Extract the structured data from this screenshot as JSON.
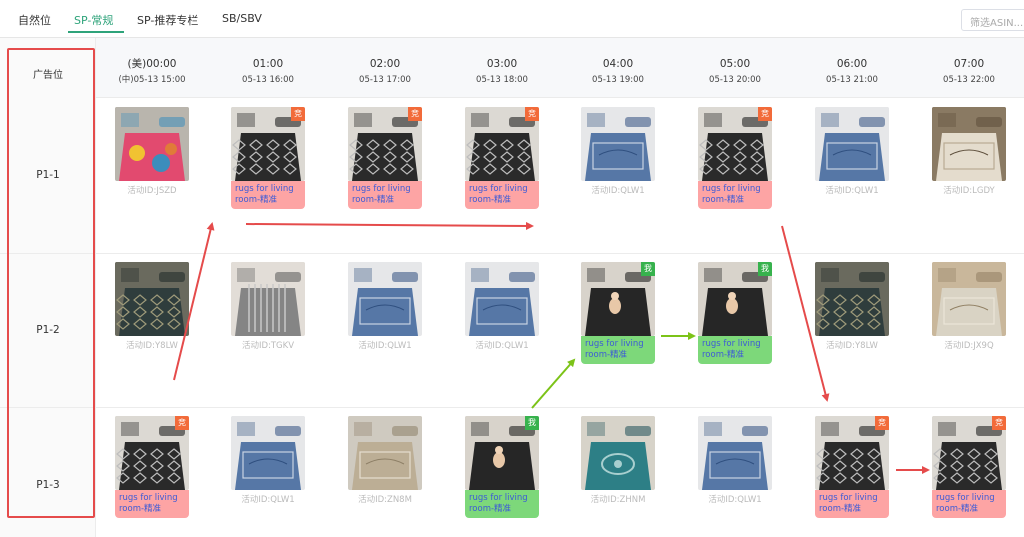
{
  "tabs": [
    {
      "label": "自然位",
      "active": false
    },
    {
      "label": "SP-常规",
      "active": true
    },
    {
      "label": "SP-推荐专栏",
      "active": false
    },
    {
      "label": "SB/SBV",
      "active": false
    }
  ],
  "filter": {
    "placeholder": "筛选ASIN..."
  },
  "header": {
    "slot_label": "广告位"
  },
  "columns": [
    {
      "us_time": "(美)00:00",
      "cn_time": "(中)05-13 15:00"
    },
    {
      "us_time": "01:00",
      "cn_time": "05-13 16:00"
    },
    {
      "us_time": "02:00",
      "cn_time": "05-13 17:00"
    },
    {
      "us_time": "03:00",
      "cn_time": "05-13 18:00"
    },
    {
      "us_time": "04:00",
      "cn_time": "05-13 19:00"
    },
    {
      "us_time": "05:00",
      "cn_time": "05-13 20:00"
    },
    {
      "us_time": "06:00",
      "cn_time": "05-13 21:00"
    },
    {
      "us_time": "07:00",
      "cn_time": "05-13 22:00"
    }
  ],
  "rows": [
    {
      "label": "P1-1",
      "cells": [
        {
          "kind": "id",
          "text": "活动ID:JSZD",
          "style": "colorful-rug"
        },
        {
          "kind": "keyword",
          "tag": "竞",
          "text": "rugs for living room-精准",
          "style": "black-diamond-rug"
        },
        {
          "kind": "keyword",
          "tag": "竞",
          "text": "rugs for living room-精准",
          "style": "black-diamond-rug"
        },
        {
          "kind": "keyword",
          "tag": "竞",
          "text": "rugs for living room-精准",
          "style": "black-diamond-rug"
        },
        {
          "kind": "id",
          "text": "活动ID:QLW1",
          "style": "blue-rug"
        },
        {
          "kind": "keyword",
          "tag": "竞",
          "text": "rugs for living room-精准",
          "style": "black-diamond-rug"
        },
        {
          "kind": "id",
          "text": "活动ID:QLW1",
          "style": "blue-rug"
        },
        {
          "kind": "id",
          "text": "活动ID:LGDY",
          "style": "cream-rug"
        }
      ]
    },
    {
      "label": "P1-2",
      "cells": [
        {
          "kind": "id",
          "text": "活动ID:Y8LW",
          "style": "dark-floral-rug"
        },
        {
          "kind": "id",
          "text": "活动ID:TGKV",
          "style": "grey-striped-rug"
        },
        {
          "kind": "id",
          "text": "活动ID:QLW1",
          "style": "blue-rug"
        },
        {
          "kind": "id",
          "text": "活动ID:QLW1",
          "style": "blue-rug"
        },
        {
          "kind": "keyword",
          "tag": "我",
          "tag_type": "mine",
          "text": "rugs for living room-精准",
          "style": "black-shag-rug"
        },
        {
          "kind": "keyword",
          "tag": "我",
          "tag_type": "mine",
          "text": "rugs for living room-精准",
          "style": "black-shag-rug"
        },
        {
          "kind": "id",
          "text": "活动ID:Y8LW",
          "style": "dark-floral-rug"
        },
        {
          "kind": "id",
          "text": "活动ID:JX9Q",
          "style": "beige-room-rug"
        }
      ]
    },
    {
      "label": "P1-3",
      "cells": [
        {
          "kind": "keyword",
          "tag": "竞",
          "text": "rugs for living room-精准",
          "style": "black-diamond-rug"
        },
        {
          "kind": "id",
          "text": "活动ID:QLW1",
          "style": "blue-rug"
        },
        {
          "kind": "id",
          "text": "活动ID:ZN8M",
          "style": "beige-leaf-rug"
        },
        {
          "kind": "keyword",
          "tag": "我",
          "tag_type": "mine",
          "text": "rugs for living room-精准",
          "style": "black-shag-rug"
        },
        {
          "kind": "id",
          "text": "活动ID:ZHNM",
          "style": "teal-medallion-rug"
        },
        {
          "kind": "id",
          "text": "活动ID:QLW1",
          "style": "blue-rug"
        },
        {
          "kind": "keyword",
          "tag": "竞",
          "text": "rugs for living room-精准",
          "style": "black-diamond-rug"
        },
        {
          "kind": "keyword",
          "tag": "竞",
          "text": "rugs for living room-精准",
          "style": "black-diamond-rug"
        }
      ]
    }
  ],
  "colors": {
    "accent": "#2ea37a",
    "competitor_tag": "#f26b3a",
    "mine_tag": "#37b24d",
    "competitor_caption": "#fda4a4",
    "mine_caption": "#7dd87a",
    "caption_text": "#3d5bd6",
    "red_arrow": "#e54b4b",
    "green_arrow": "#7cc318"
  }
}
